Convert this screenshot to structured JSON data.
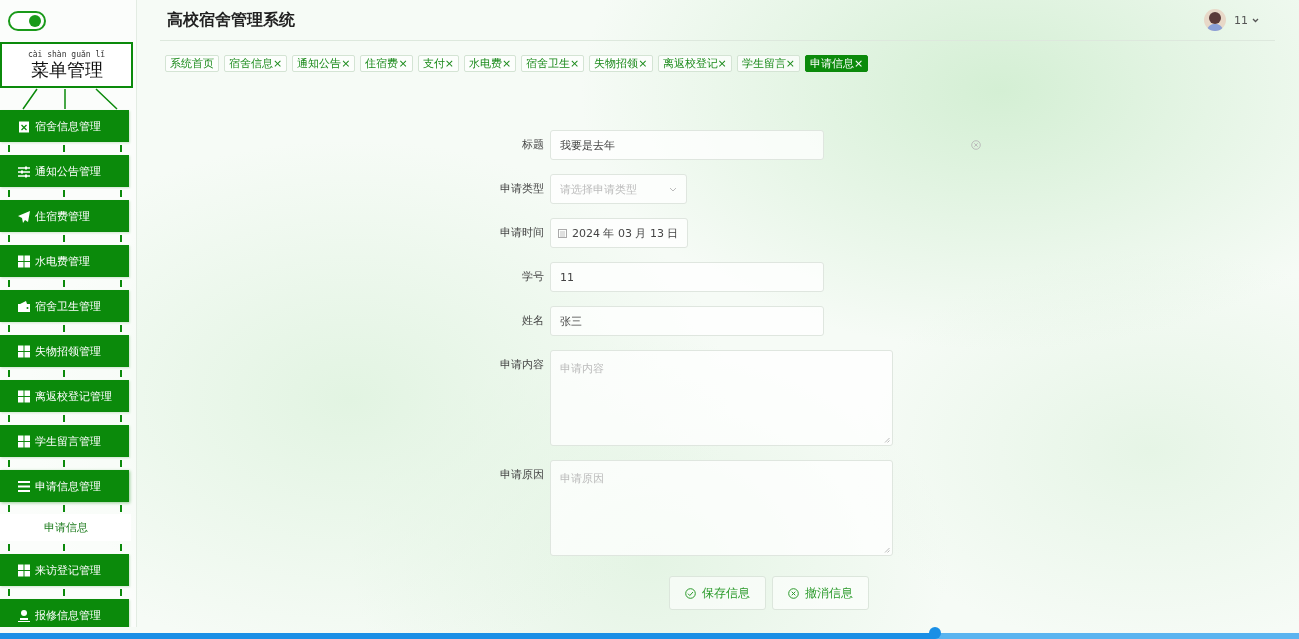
{
  "sidebar": {
    "switch": {
      "on": true
    },
    "menu_title": {
      "pinyin": "cài shàn guǎn lǐ",
      "label": "菜单管理"
    },
    "items": [
      {
        "label": "宿舍信息管理",
        "expanded": false
      },
      {
        "label": "通知公告管理",
        "expanded": false
      },
      {
        "label": "住宿费管理",
        "expanded": false
      },
      {
        "label": "水电费管理",
        "expanded": false
      },
      {
        "label": "宿舍卫生管理",
        "expanded": false
      },
      {
        "label": "失物招领管理",
        "expanded": false
      },
      {
        "label": "离返校登记管理",
        "expanded": false
      },
      {
        "label": "学生留言管理",
        "expanded": false
      },
      {
        "label": "申请信息管理",
        "expanded": true,
        "children": [
          {
            "label": "申请信息",
            "selected": true
          }
        ]
      },
      {
        "label": "来访登记管理",
        "expanded": false
      },
      {
        "label": "报修信息管理",
        "expanded": false
      }
    ]
  },
  "header": {
    "title": "高校宿舍管理系统",
    "user": "11"
  },
  "tabs": [
    {
      "label": "系统首页",
      "selected": false
    },
    {
      "label": "宿舍信息",
      "close": "×",
      "selected": false
    },
    {
      "label": "通知公告",
      "close": "×",
      "selected": false
    },
    {
      "label": "住宿费",
      "close": "×",
      "selected": false
    },
    {
      "label": "支付",
      "close": "×",
      "selected": false
    },
    {
      "label": "水电费",
      "close": "×",
      "selected": false
    },
    {
      "label": "宿舍卫生",
      "close": "×",
      "selected": false
    },
    {
      "label": "失物招领",
      "close": "×",
      "selected": false
    },
    {
      "label": "离返校登记",
      "close": "×",
      "selected": false
    },
    {
      "label": "学生留言",
      "close": "×",
      "selected": false
    },
    {
      "label": "申请信息",
      "close": "×",
      "selected": true
    }
  ],
  "form": {
    "fields": [
      {
        "kind": "input",
        "label": "标题",
        "value": "我要是去年",
        "clearable": true
      },
      {
        "kind": "select",
        "label": "申请类型",
        "placeholder": "请选择申请类型"
      },
      {
        "kind": "date",
        "label": "申请时间",
        "value": "2024 年 03 月 13 日"
      },
      {
        "kind": "input",
        "label": "学号",
        "value": "11"
      },
      {
        "kind": "input",
        "label": "姓名",
        "value": "张三"
      },
      {
        "kind": "textarea",
        "label": "申请内容",
        "placeholder": "申请内容"
      },
      {
        "kind": "textarea",
        "label": "申请原因",
        "placeholder": "申请原因"
      }
    ],
    "buttons": [
      {
        "kind": "save",
        "label": "保存信息"
      },
      {
        "kind": "cancel",
        "label": "撤消信息"
      }
    ]
  },
  "playback_bar": {
    "level": 0.72
  }
}
